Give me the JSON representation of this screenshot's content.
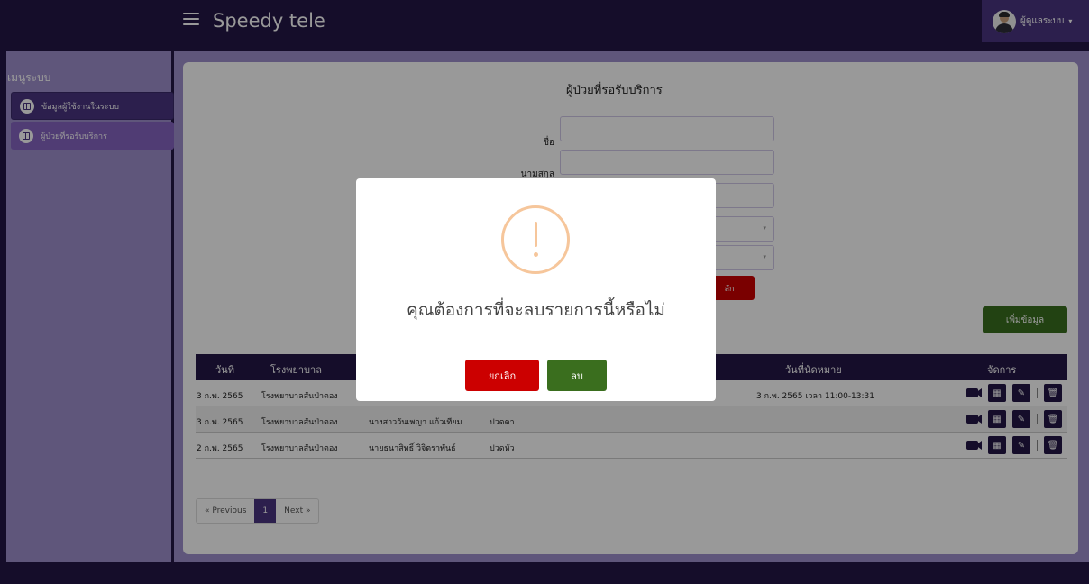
{
  "header": {
    "app_title": "Speedy tele",
    "user_name": "ผู้ดูแลระบบ",
    "caret": "▾"
  },
  "sidebar": {
    "title": "เมนูระบบ",
    "items": [
      {
        "label": "ข้อมูลผู้ใช้งานในระบบ"
      },
      {
        "label": "ผู้ป่วยที่รอรับบริการ"
      }
    ]
  },
  "main": {
    "card_title": "ผู้ป่วยที่รอรับบริการ",
    "form": {
      "first_name_label": "ชื่อ",
      "last_name_label": "นามสกุล",
      "partial_button": "ลัก"
    },
    "add_button": "เพิ่มข้อมูล",
    "table": {
      "headers": [
        "วันที่",
        "โรงพยาบาล",
        "วันที่นัดหมาย",
        "จัดการ"
      ],
      "rows": [
        {
          "date": "3 ก.พ. 2565",
          "hospital": "โรงพยาบาลสันป่าตอง",
          "name": "",
          "symptom": "",
          "appointment": "3 ก.พ. 2565 เวลา 11:00-13:31"
        },
        {
          "date": "3 ก.พ. 2565",
          "hospital": "โรงพยาบาลสันป่าตอง",
          "name": "นางสาววันเพญา แก้วเทียม",
          "symptom": "ปวดตา",
          "appointment": ""
        },
        {
          "date": "2 ก.พ. 2565",
          "hospital": "โรงพยาบาลสันป่าตอง",
          "name": "นายธนาสิทธิ์ วิจิตราพันธ์",
          "symptom": "ปวดหัว",
          "appointment": ""
        }
      ]
    },
    "pager": {
      "previous": "« Previous",
      "page": "1",
      "next": "Next »"
    }
  },
  "modal": {
    "message": "คุณต้องการที่จะลบรายการนี้หรือไม่",
    "cancel_label": "ยกเลิก",
    "confirm_label": "ลบ",
    "icon": "warning-circle-icon"
  },
  "colors": {
    "nav": "#231646",
    "panel": "#9f8fcd",
    "accent": "#4a3581",
    "danger": "#cc0000",
    "success": "#3a6e1e",
    "warning": "#f6c69b"
  }
}
